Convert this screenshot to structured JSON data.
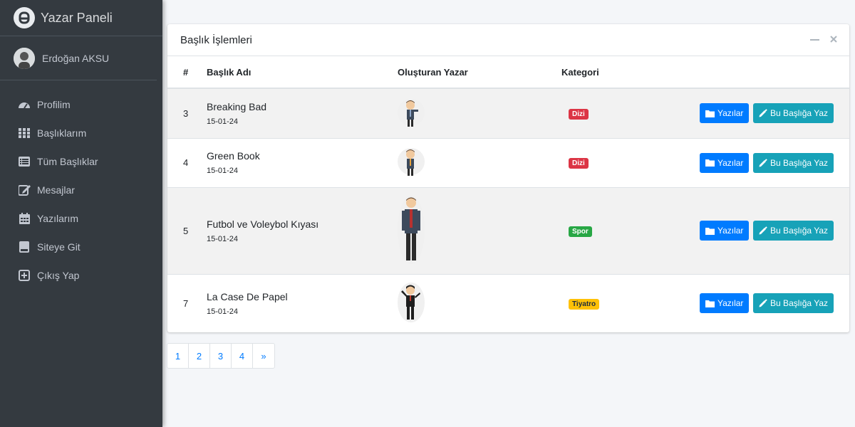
{
  "sidebar": {
    "brand": "Yazar Paneli",
    "user_name": "Erdoğan AKSU",
    "items": [
      {
        "label": "Profilim",
        "icon": "dashboard-icon"
      },
      {
        "label": "Başlıklarım",
        "icon": "grid-icon"
      },
      {
        "label": "Tüm Başlıklar",
        "icon": "list-icon"
      },
      {
        "label": "Mesajlar",
        "icon": "edit-icon"
      },
      {
        "label": "Yazılarım",
        "icon": "calendar-icon"
      },
      {
        "label": "Siteye Git",
        "icon": "book-icon"
      },
      {
        "label": "Çıkış Yap",
        "icon": "plus-square-icon"
      }
    ]
  },
  "card": {
    "title": "Başlık İşlemleri",
    "columns": [
      "#",
      "Başlık Adı",
      "Oluşturan Yazar",
      "Kategori"
    ],
    "rows": [
      {
        "id": "3",
        "title": "Breaking Bad",
        "date": "15-01-24",
        "category": "Dizi",
        "category_style": "dizi"
      },
      {
        "id": "4",
        "title": "Green Book",
        "date": "15-01-24",
        "category": "Dizi",
        "category_style": "dizi"
      },
      {
        "id": "5",
        "title": "Futbol ve Voleybol Kıyası",
        "date": "15-01-24",
        "category": "Spor",
        "category_style": "spor"
      },
      {
        "id": "7",
        "title": "La Case De Papel",
        "date": "15-01-24",
        "category": "Tiyatro",
        "category_style": "tiyatro"
      }
    ],
    "buttons": {
      "posts": "Yazılar",
      "write": "Bu Başlığa Yaz"
    }
  },
  "pagination": [
    "1",
    "2",
    "3",
    "4",
    "»"
  ],
  "colors": {
    "sidebar": "#343a40",
    "primary": "#007bff",
    "info": "#17a2b8",
    "danger": "#dc3545",
    "success": "#28a745",
    "warning": "#ffc107"
  }
}
